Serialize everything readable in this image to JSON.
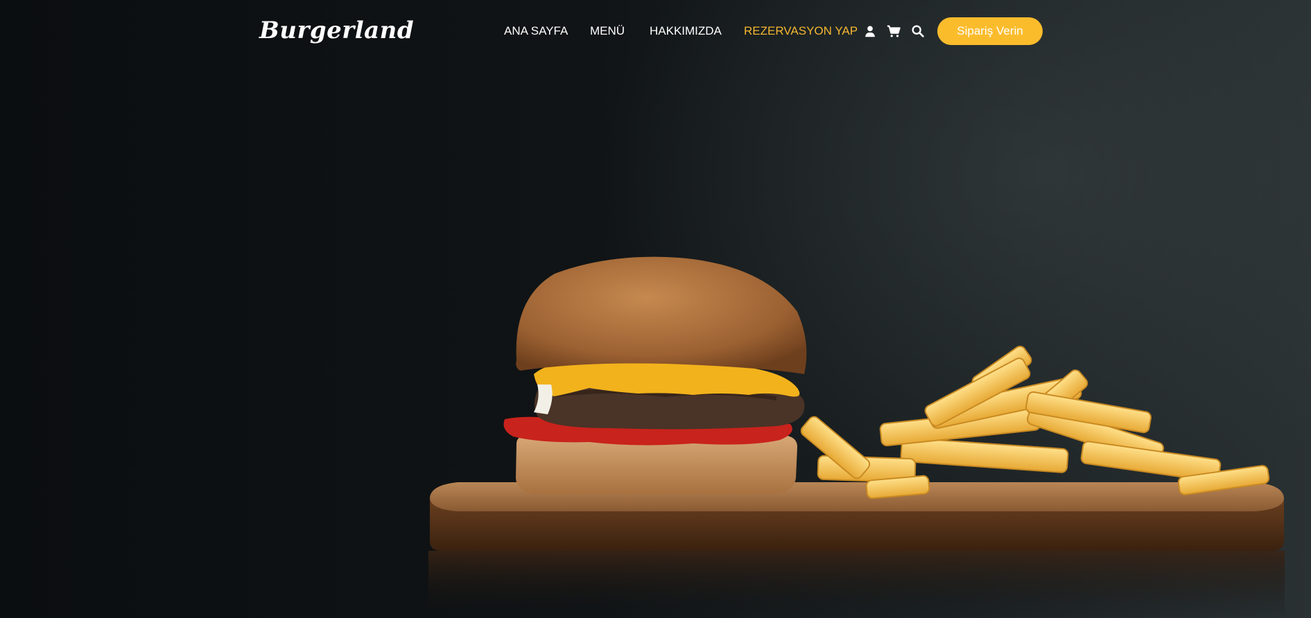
{
  "brand": {
    "logo_text": "Burgerland"
  },
  "nav": {
    "items": [
      {
        "label": "ANA SAYFA",
        "active": false
      },
      {
        "label": "MENÜ",
        "active": false
      },
      {
        "label": "HAKKIMIZDA",
        "active": false
      },
      {
        "label": "REZERVASYON YAP",
        "active": true
      }
    ],
    "icons": [
      "user-icon",
      "cart-icon",
      "search-icon"
    ],
    "cta_label": "Sipariş Verin"
  },
  "colors": {
    "accent": "#fbbc2c",
    "active_link": "#f5b731",
    "text": "#ffffff",
    "background": "#0d1012"
  },
  "hero": {
    "image_subject": "burger-and-fries-on-wooden-board"
  }
}
